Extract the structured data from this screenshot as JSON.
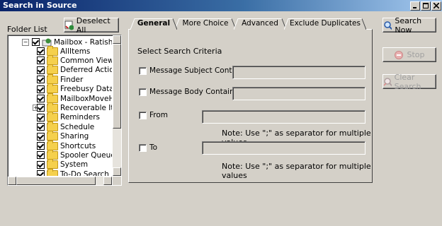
{
  "window": {
    "title": "Search in Source"
  },
  "folder_list": {
    "label": "Folder List",
    "deselect_label": "Deselect All",
    "root": "Mailbox - Ratish Nair",
    "items": [
      "AllItems",
      "Common Views",
      "Deferred Action",
      "Finder",
      "Freebusy Data",
      "MailboxMoveHistory",
      "Recoverable Items",
      "Reminders",
      "Schedule",
      "Sharing",
      "Shortcuts",
      "Spooler Queue",
      "System",
      "To-Do Search"
    ]
  },
  "tabs": [
    "General",
    "More Choice",
    "Advanced",
    "Exclude Duplicates"
  ],
  "general": {
    "heading": "Select Search Criteria",
    "subject_label": "Message Subject Containing",
    "body_label": "Message Body Containing",
    "from_label": "From",
    "to_label": "To",
    "note": "Note: Use \";\" as separator for multiple values"
  },
  "actions": {
    "search_now": "Search Now",
    "stop": "Stop",
    "clear_search": "Clear Search"
  }
}
